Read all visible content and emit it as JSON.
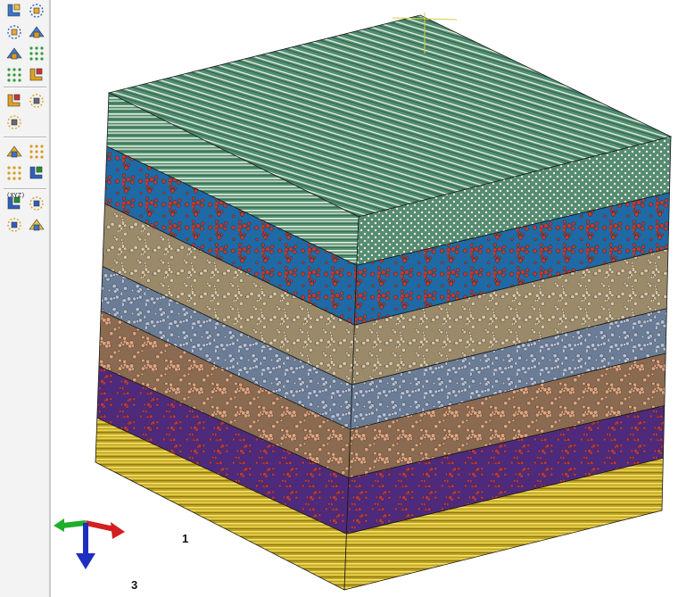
{
  "toolbox": {
    "tools": [
      [
        "create-partition-icon",
        "seed-grid-icon"
      ],
      [
        "seed-edges-icon",
        "seed-part-icon"
      ],
      [
        "mesh-region-icon",
        "mesh-part-icon"
      ],
      [
        "element-type-icon",
        "verify-mesh-icon"
      ],
      [
        "edit-mesh-icon",
        "assign-mesh-controls-icon"
      ],
      [
        "query-tool-icon"
      ],
      [
        "select-tool-icon",
        "partition-face-icon"
      ],
      [
        "virtual-topology-icon",
        "partition-cell-icon"
      ],
      [
        "create-datum-point-icon",
        "create-datum-axis-icon"
      ],
      [
        "create-datum-plane-icon",
        "create-datum-csys-icon"
      ]
    ],
    "xyz_label": "(XYZ)"
  },
  "viewport": {
    "triad": {
      "axis_1_label": "1",
      "axis_3_label": "3",
      "colors": {
        "axis_1": "#d31f1f",
        "axis_2": "#1fae2a",
        "axis_3": "#1d2fbf"
      }
    },
    "model": {
      "layers": [
        {
          "name": "fiber-layer-top",
          "color": "#4f8f73",
          "pattern": "stripes",
          "fiber": "#e8edd9",
          "top_face": true
        },
        {
          "name": "layer-red-dots",
          "color": "#1f6aa5",
          "pattern": "dots",
          "dot": "#c33a2e"
        },
        {
          "name": "layer-tan",
          "color": "#9a8a6a",
          "pattern": "dots",
          "dot": "#d7c6a4"
        },
        {
          "name": "layer-blue-gray",
          "color": "#6b7d96",
          "pattern": "dots",
          "dot": "#b7c0d6"
        },
        {
          "name": "layer-orange",
          "color": "#8a6a50",
          "pattern": "dots",
          "dot": "#e0a47e"
        },
        {
          "name": "layer-purple",
          "color": "#4e2a7d",
          "pattern": "dots",
          "dot": "#b43a4e"
        },
        {
          "name": "layer-yellow",
          "color": "#bfa31e",
          "pattern": "stripes",
          "fiber": "#f4e26a"
        }
      ]
    }
  }
}
